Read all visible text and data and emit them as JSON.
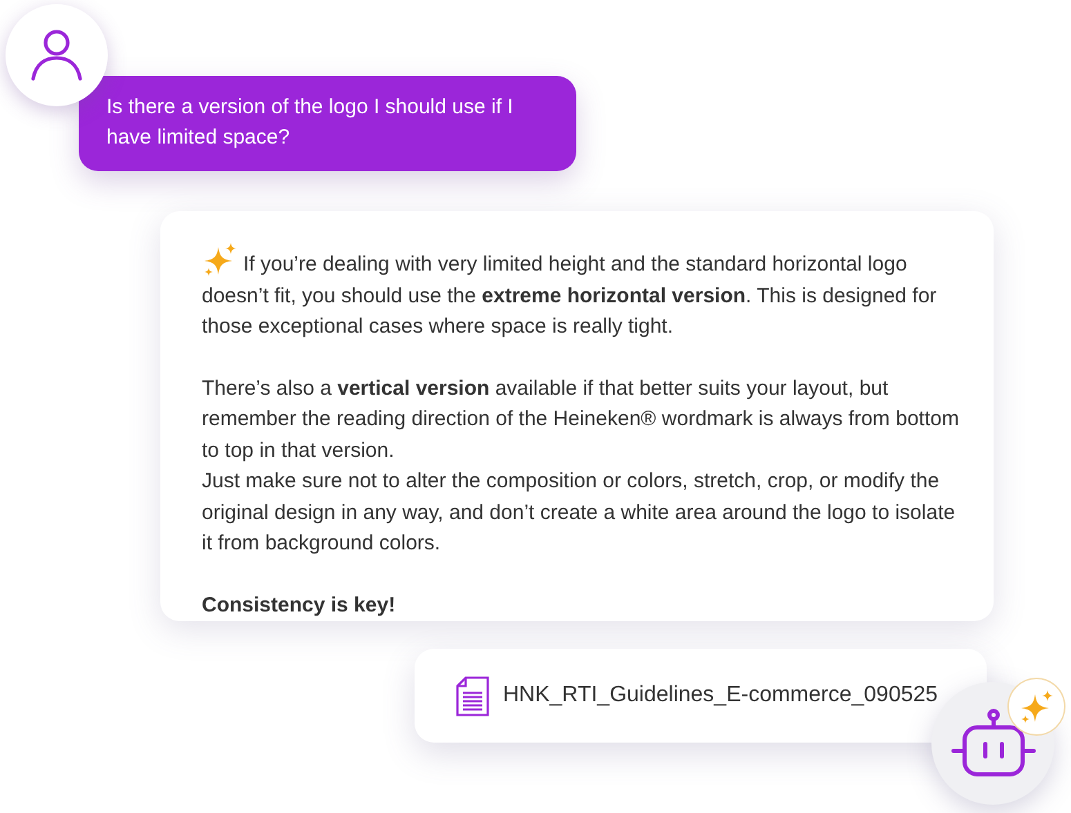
{
  "question": {
    "text": "Is there a version of the logo I should use if I have limited space?"
  },
  "answer": {
    "sections": [
      [
        {
          "kind": "plain",
          "text": "If you’re dealing with very limited height and the standard horizontal logo doesn’t fit, you should use the **extreme horizontal version**. This is designed for those exceptional cases where space is really tight."
        }
      ],
      [
        {
          "kind": "plain",
          "text": "There’s also a **vertical version** available if that better suits your layout, but remember the reading direction of the Heineken® wordmark is always from bottom to top in that version."
        },
        {
          "kind": "plain",
          "text": "Just make sure not to alter the composition or colors, stretch, crop, or modify the original design in any way, and don’t create a white area around the logo to isolate it from background colors."
        }
      ],
      [
        {
          "kind": "strong",
          "text": "Consistency is key!"
        }
      ]
    ]
  },
  "attachment": {
    "file_name": "HNK_RTI_Guidelines_E-commerce_090525"
  }
}
